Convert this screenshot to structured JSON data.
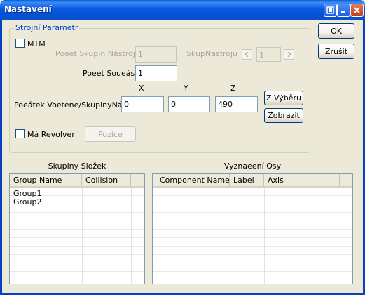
{
  "window": {
    "title": "Nastavení",
    "controls": [
      "help-icon",
      "minimize-icon",
      "close-icon"
    ]
  },
  "group": {
    "legend": "Strojní Parametr",
    "mtm_label": "MTM",
    "pocet_skupin_label": "Poeet Skupin Nástroju",
    "pocet_skupin_value": "1",
    "skup_nastroju_label": "SkupNastroju",
    "skup_nastroju_value": "1",
    "pocet_soucasti_label": "Poeet Soueástí",
    "pocet_soucasti_value": "1",
    "axis_x": "X",
    "axis_y": "Y",
    "axis_z": "Z",
    "pocatek_label": "Poeátek Voetene/SkupinyNást",
    "x_value": "0",
    "y_value": "0",
    "z_value": "490",
    "z_vyberu": "Z Výběru",
    "zobrazit": "Zobrazit",
    "ma_revolver_label": "Má Revolver",
    "pozice": "Pozice"
  },
  "buttons": {
    "ok": "OK",
    "zrusit": "Zrušit"
  },
  "skupiny": {
    "caption": "Skupiny Složek",
    "columns": [
      "Group Name",
      "Collision"
    ],
    "rows": [
      "Group1",
      "Group2"
    ]
  },
  "osy": {
    "caption": "Vyznaeení Osy",
    "columns": [
      "Component Name",
      "Label",
      "Axis"
    ]
  }
}
